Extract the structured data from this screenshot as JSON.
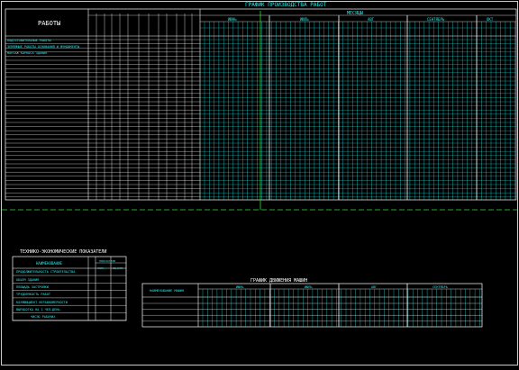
{
  "drawing": {
    "main_title": "ГРАФИК ПРОИЗВОДСТВА РАБОТ",
    "schedule": {
      "left_header": "РАБОТЫ",
      "rows_text": [
        "ПОДГОТОВИТЕЛЬНЫЕ РАБОТЫ",
        "ЗЕМЛЯНЫЕ РАБОТЫ ОСНОВАНИЯ И ФУНДАМЕНТЫ",
        "МОНТАЖ КАРКАСА ЗДАНИЯ"
      ],
      "timeline_label": "МЕСЯЦЫ",
      "months": [
        "ИЮНЬ",
        "ИЮЛЬ",
        "АВГ",
        "СЕНТЯБРЬ",
        "ОКТ"
      ]
    },
    "tep": {
      "title": "ТЕХНИКО-ЭКОНОМИЧЕСКИЕ ПОКАЗАТЕЛИ",
      "col_name": "НАИМЕНОВАНИЕ",
      "col_values": "ПОКАЗАТЕЛИ",
      "col_sub": [
        "ЗНАЧ.",
        "ЕД.ИЗМ."
      ],
      "rows": [
        "ПРОДОЛЖИТЕЛЬНОСТЬ СТРОИТЕЛЬСТВА",
        "ОБЪЕМ ЗДАНИЯ",
        "ПЛОЩАДЬ ЗАСТРОЙКИ",
        "ТРУДОЕМКОСТЬ РАБОТ",
        "КОЭФФИЦИЕНТ НЕРАВНОМЕРНОСТИ",
        "ВЫРАБОТКА НА 1 ЧЕЛ-ДЕНЬ",
        "ЧИСЛО РАБОЧИХ"
      ]
    },
    "machines": {
      "title": "ГРАФИК ДВИЖЕНИЯ МАШИН",
      "row_label": "НАИМЕНОВАНИЕ МАШИН",
      "months": [
        "ИЮНЬ",
        "ИЮЛЬ",
        "АВГ",
        "СЕНТЯБРЬ"
      ]
    },
    "colors": {
      "background": "#000000",
      "lines": "#ffffff",
      "cyan": "#2ee6e6",
      "green": "#2fe02f",
      "yellow": "#e8e83a"
    }
  }
}
